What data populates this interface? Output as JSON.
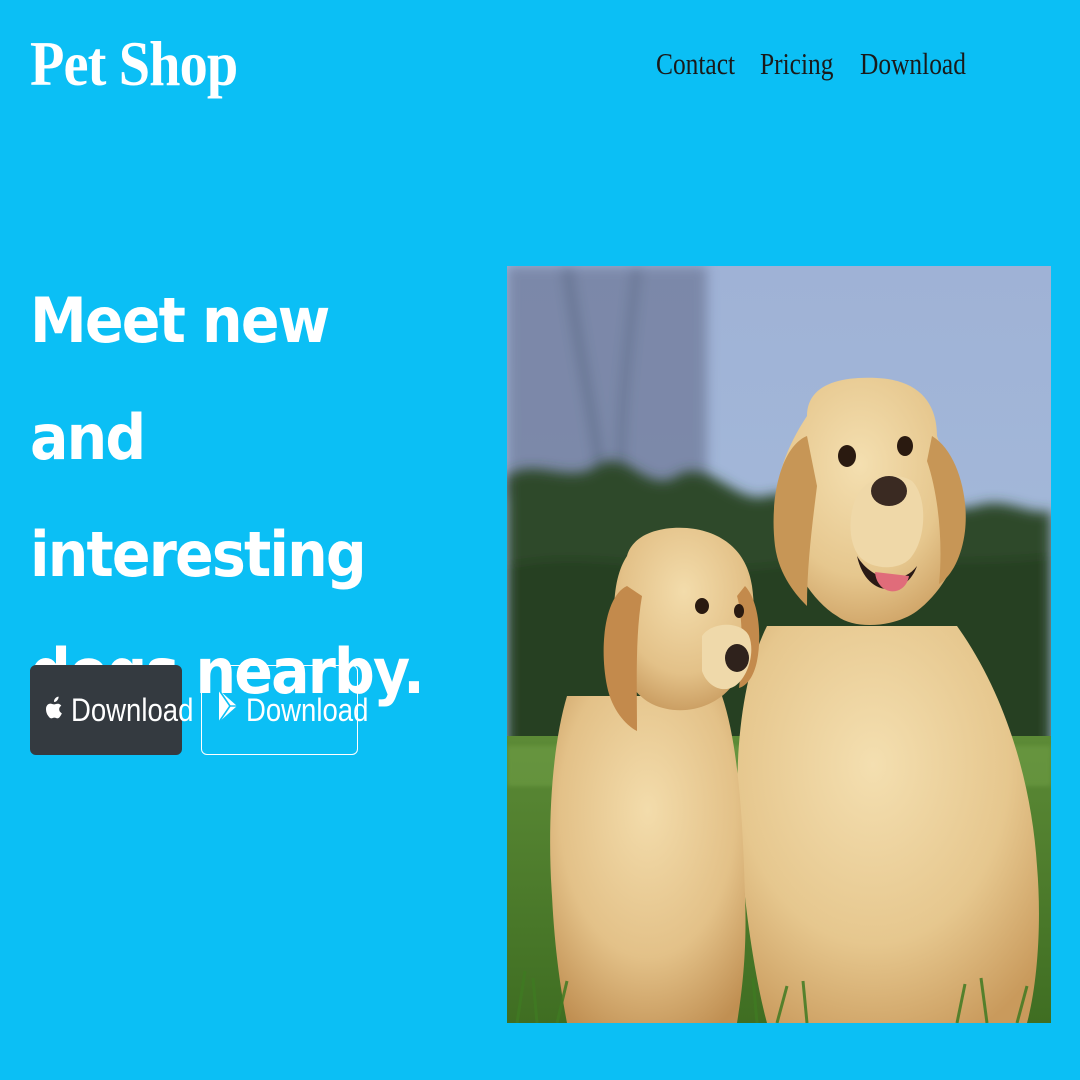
{
  "brand": {
    "name": "Pet Shop"
  },
  "nav": {
    "items": [
      {
        "label": "Contact"
      },
      {
        "label": "Pricing"
      },
      {
        "label": "Download"
      }
    ]
  },
  "hero": {
    "headline": "Meet new and interesting dogs nearby.",
    "buttons": {
      "apple": {
        "label": "Download",
        "icon": "apple-icon"
      },
      "google": {
        "label": "Download",
        "icon": "google-play-icon"
      }
    },
    "image": {
      "subject": "two golden retriever dogs sitting on grass"
    }
  },
  "colors": {
    "background": "#0bbff5",
    "text_light": "#ffffff",
    "nav_text": "#1a1a1a",
    "button_dark": "#343a40"
  }
}
